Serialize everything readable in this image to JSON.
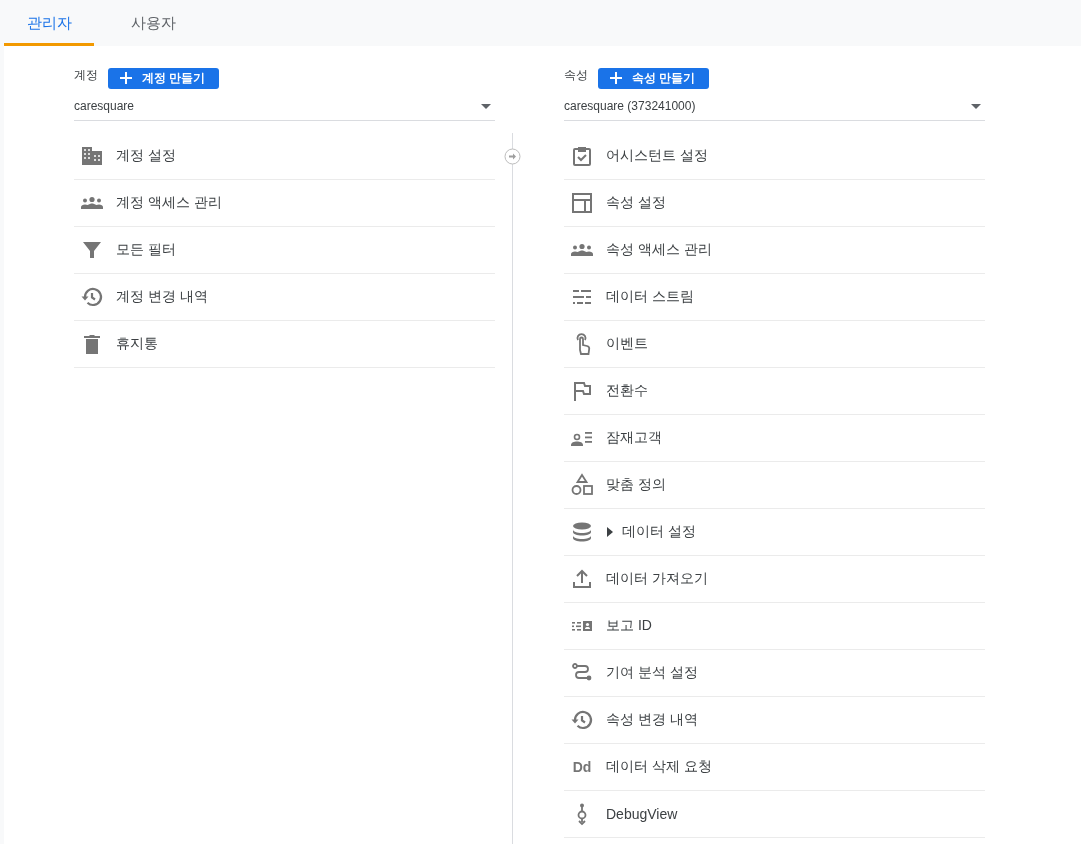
{
  "tabs": [
    {
      "label": "관리자",
      "selected": true
    },
    {
      "label": "사용자",
      "selected": false
    }
  ],
  "account": {
    "label": "계정",
    "create_button": "계정 만들기",
    "selector": {
      "value": "caresquare"
    },
    "items": [
      {
        "label": "계정 설정"
      },
      {
        "label": "계정 액세스 관리"
      },
      {
        "label": "모든 필터"
      },
      {
        "label": "계정 변경 내역"
      },
      {
        "label": "휴지통"
      }
    ]
  },
  "property": {
    "label": "속성",
    "create_button": "속성 만들기",
    "selector": {
      "value": "caresquare (373241000)"
    },
    "items": [
      {
        "label": "어시스턴트 설정"
      },
      {
        "label": "속성 설정"
      },
      {
        "label": "속성 액세스 관리"
      },
      {
        "label": "데이터 스트림"
      },
      {
        "label": "이벤트"
      },
      {
        "label": "전환수"
      },
      {
        "label": "잠재고객"
      },
      {
        "label": "맞춤 정의"
      },
      {
        "label": "데이터 설정",
        "expanded": false
      },
      {
        "label": "데이터 가져오기"
      },
      {
        "label": "보고 ID"
      },
      {
        "label": "기여 분석 설정"
      },
      {
        "label": "속성 변경 내역"
      },
      {
        "label": "데이터 삭제 요청",
        "icon_text": "Dd"
      },
      {
        "label": "DebugView"
      }
    ]
  }
}
